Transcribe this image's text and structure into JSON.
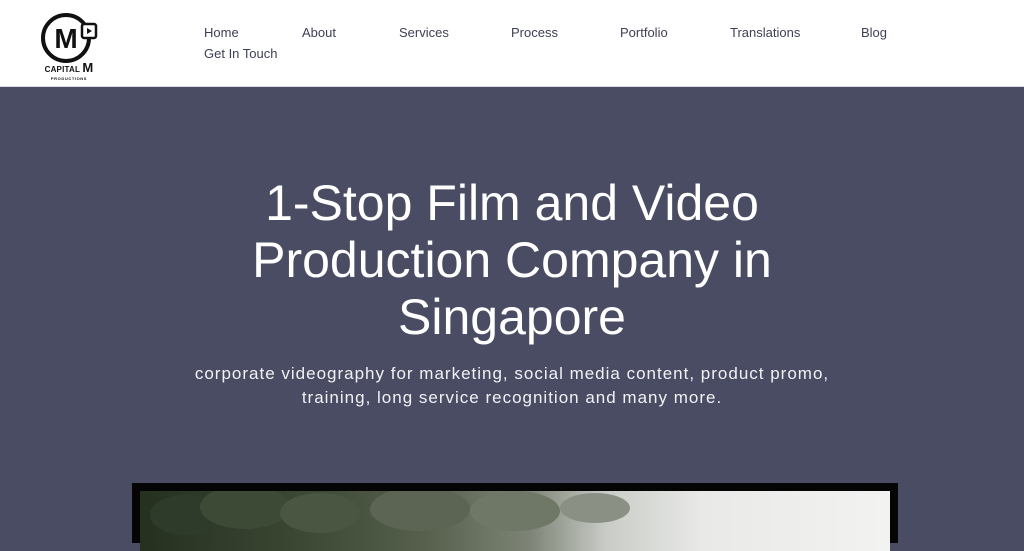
{
  "logo": {
    "mark_letter": "M",
    "name_line1": "CAPITAL",
    "name_line1_m": "M",
    "name_line2": "PRODUCTIONS"
  },
  "nav": {
    "items": [
      {
        "label": "Home"
      },
      {
        "label": "About"
      },
      {
        "label": "Services"
      },
      {
        "label": "Process"
      },
      {
        "label": "Portfolio"
      },
      {
        "label": "Translations"
      },
      {
        "label": "Blog"
      },
      {
        "label": "Get In Touch"
      }
    ]
  },
  "hero": {
    "title": "1-Stop Film and Video Production Company in Singapore",
    "subtitle": "corporate videography for marketing, social media content, product promo, training, long service recognition and many more."
  },
  "colors": {
    "hero_background": "#4a4c63",
    "nav_text": "#3d3f55",
    "header_background": "#ffffff"
  }
}
